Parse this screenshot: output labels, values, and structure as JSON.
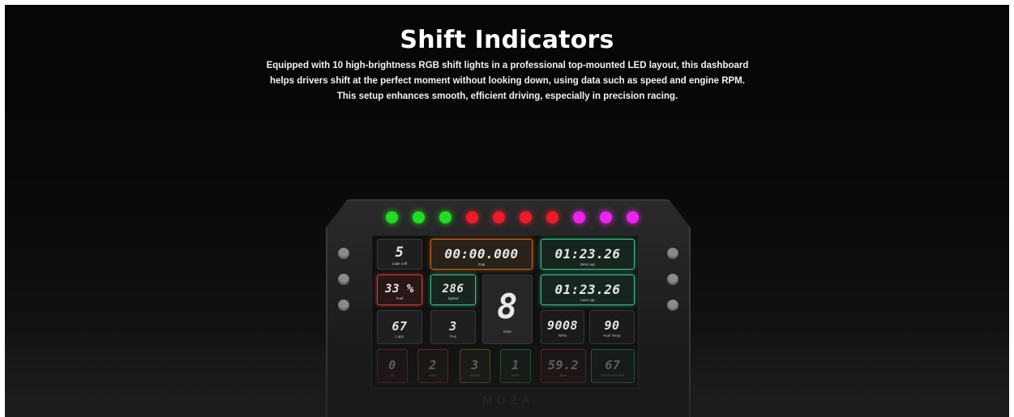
{
  "header": {
    "title": "Shift Indicators",
    "description_lines": [
      "Equipped with 10 high-brightness RGB shift lights in a professional top-mounted LED layout, this dashboard",
      "helps drivers shift at the perfect moment without looking down, using data such as speed and engine RPM.",
      "This setup enhances smooth, efficient driving, especially in precision racing."
    ]
  },
  "device": {
    "brand": "MOZA",
    "shift_lights": [
      "#22dd22",
      "#22dd22",
      "#22dd22",
      "#ee1a2a",
      "#ee1a2a",
      "#ee1a2a",
      "#ee1a2a",
      "#ee22ee",
      "#ee22ee",
      "#ee22ee"
    ],
    "tiles": {
      "laps_left": {
        "value": "5",
        "label": "Laps Left"
      },
      "gap": {
        "value": "00:00.000",
        "label": "Gap"
      },
      "best_lap": {
        "value": "01:23.26",
        "label": "Best Lap"
      },
      "fuel": {
        "value": "33 %",
        "label": "Fuel"
      },
      "speed": {
        "value": "286",
        "label": "Speed"
      },
      "gear": {
        "value": "8",
        "label": "Gear"
      },
      "last_lap": {
        "value": "01:23.26",
        "label": "Last Lap"
      },
      "laps": {
        "value": "67",
        "label": "Laps"
      },
      "pos": {
        "value": "3",
        "label": "Pos"
      },
      "rpm": {
        "value": "9008",
        "label": "RPM"
      },
      "fuel_temp": {
        "value": "90",
        "label": "Fuel Temp"
      },
      "tc": {
        "value": "0",
        "label": "TC"
      },
      "abs": {
        "value": "2",
        "label": "ABS"
      },
      "boost": {
        "value": "3",
        "label": "Boost"
      },
      "map": {
        "value": "1",
        "label": "MAP"
      },
      "bias": {
        "value": "59.2",
        "label": "Bias"
      },
      "fuel_consume": {
        "value": "67",
        "label": "Fuel consume"
      }
    }
  }
}
